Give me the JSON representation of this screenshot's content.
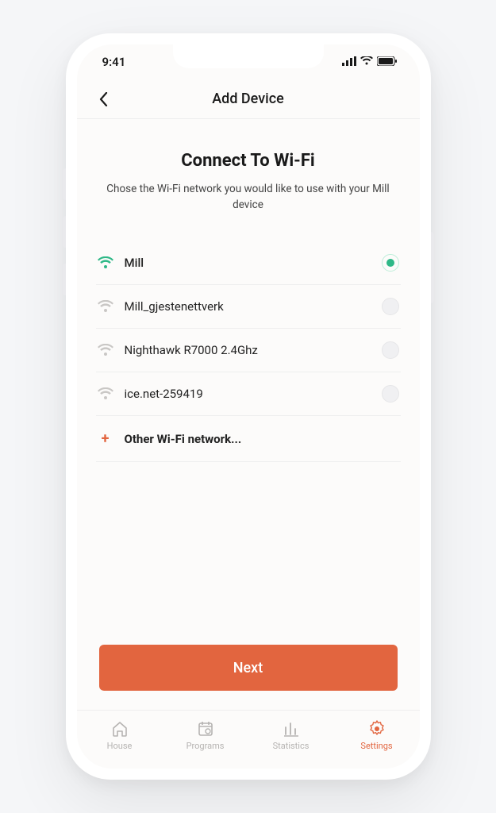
{
  "status": {
    "time": "9:41"
  },
  "nav": {
    "title": "Add Device"
  },
  "main": {
    "heading": "Connect To Wi-Fi",
    "subtext": "Chose the Wi-Fi network you would like   to use with your Mill device"
  },
  "networks": [
    {
      "name": "Mill",
      "selected": true
    },
    {
      "name": "Mill_gjestenettverk",
      "selected": false
    },
    {
      "name": "Nighthawk R7000 2.4Ghz",
      "selected": false
    },
    {
      "name": "ice.net-259419",
      "selected": false
    }
  ],
  "other_label": "Other Wi-Fi network...",
  "button": {
    "next": "Next"
  },
  "tabs": {
    "house": "House",
    "programs": "Programs",
    "statistics": "Statistics",
    "settings": "Settings"
  },
  "colors": {
    "accent": "#e2653f",
    "success": "#2eb887"
  }
}
